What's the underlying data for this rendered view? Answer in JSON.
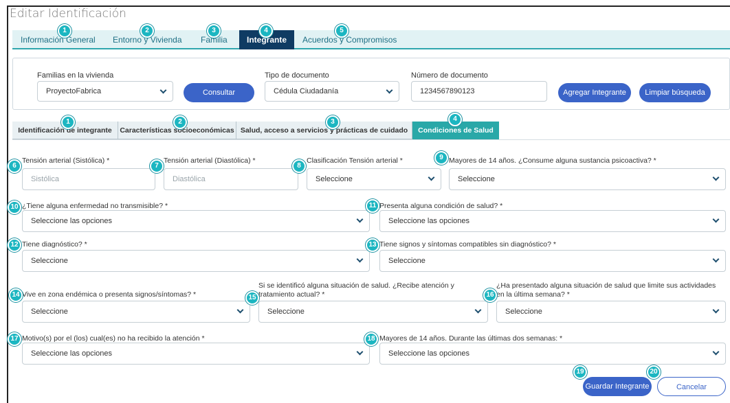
{
  "page": {
    "title": "Editar Identificación"
  },
  "top_tabs": [
    "Información General",
    "Entorno y Vivienda",
    "Familia",
    "Integrante",
    "Acuerdos y Compromisos"
  ],
  "search": {
    "familias_label": "Familias en la vivienda",
    "familias_value": "ProyectoFabrica",
    "consultar": "Consultar",
    "tipo_label": "Tipo de documento",
    "tipo_value": "Cédula Ciudadanía",
    "numero_label": "Número de documento",
    "numero_value": "1234567890123",
    "agregar": "Agregar Integrante",
    "limpiar": "Limpiar búsqueda"
  },
  "sub_tabs": [
    "Identificación de integrante",
    "Características socioeconómicas",
    "Salud, acceso a servicios y prácticas de cuidado",
    "Condiciones de Salud"
  ],
  "form": {
    "sistolica_label": "Tensión arterial (Sistólica) *",
    "sistolica_placeholder": "Sistólica",
    "diastolica_label": "Tensión arterial (Diastólica) *",
    "diastolica_placeholder": "Diastólica",
    "clasificacion_label": "Clasificación Tensión arterial *",
    "clasificacion_value": "Seleccione",
    "psicoactiva_label": "Mayores de 14 años. ¿Consume alguna sustancia psicoactiva? *",
    "psicoactiva_value": "Seleccione",
    "no_transmisible_label": "¿Tiene alguna enfermedad no transmisible? *",
    "no_transmisible_value": "Seleccione las opciones",
    "condicion_label": "Presenta alguna condición de salud? *",
    "condicion_value": "Seleccione las opciones",
    "diagnostico_label": "Tiene diagnóstico? *",
    "diagnostico_value": "Seleccione",
    "signos_label": "Tiene signos y síntomas compatibles sin diagnóstico? *",
    "signos_value": "Seleccione",
    "endemica_label": "Vive en zona endémica o presenta signos/síntomas? *",
    "endemica_value": "Seleccione",
    "atencion_label_1": "Si se identificó alguna situación de salud. ¿Recibe atención y",
    "atencion_label_2": "tratamiento actual? *",
    "atencion_value": "Seleccione",
    "limite_label_1": "¿Ha presentado alguna situación de salud que limite sus actividades",
    "limite_label_2": "en la última semana? *",
    "limite_value": "Seleccione",
    "motivos_label": "Motivo(s) por el (los) cual(es) no ha recibido la atención *",
    "motivos_value": "Seleccione las opciones",
    "dos_semanas_label": "Mayores de 14 años. Durante las últimas dos semanas: *",
    "dos_semanas_value": "Seleccione las opciones"
  },
  "actions": {
    "guardar": "Guardar Integrante",
    "cancelar": "Cancelar"
  },
  "badges": [
    "1",
    "2",
    "3",
    "4",
    "5",
    "1",
    "2",
    "3",
    "4",
    "6",
    "7",
    "8",
    "9",
    "10",
    "11",
    "12",
    "13",
    "14",
    "15",
    "16",
    "17",
    "18",
    "19",
    "20"
  ],
  "colors": {
    "accent_teal": "#29a8a8",
    "badge": "#1cb6c1",
    "nav_active": "#0f3b63",
    "button": "#3b64c8"
  }
}
